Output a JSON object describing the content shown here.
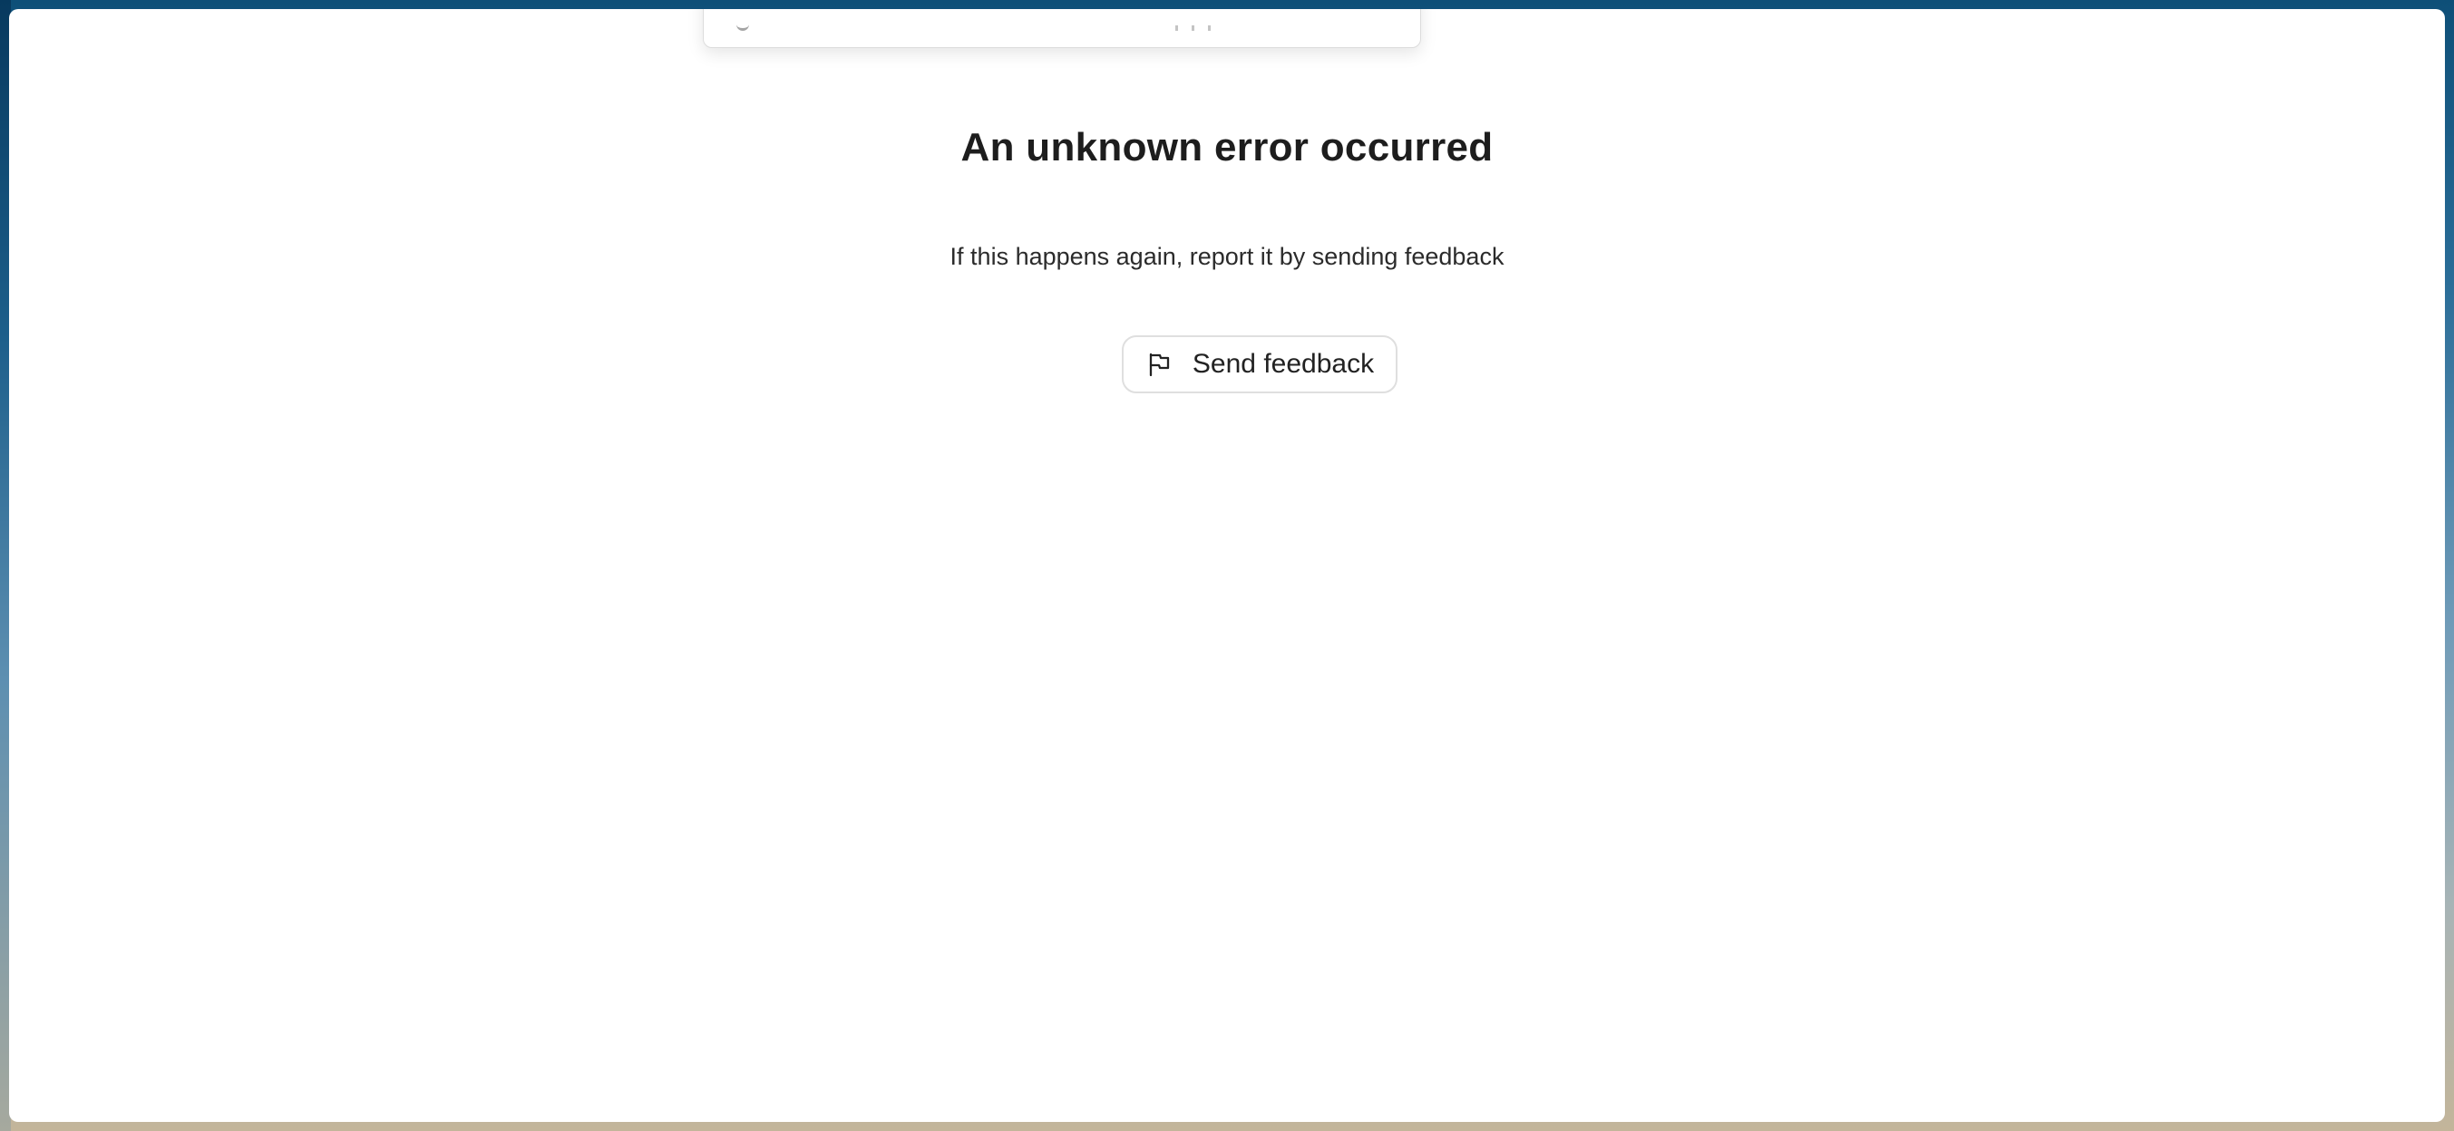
{
  "error": {
    "title": "An unknown error occurred",
    "message": "If this happens again, report it by sending feedback",
    "button_label": "Send feedback",
    "button_icon": "flag-icon"
  },
  "colors": {
    "text": "#1d1d1d",
    "button_border": "#dfdfdf",
    "window_bg": "#ffffff"
  }
}
